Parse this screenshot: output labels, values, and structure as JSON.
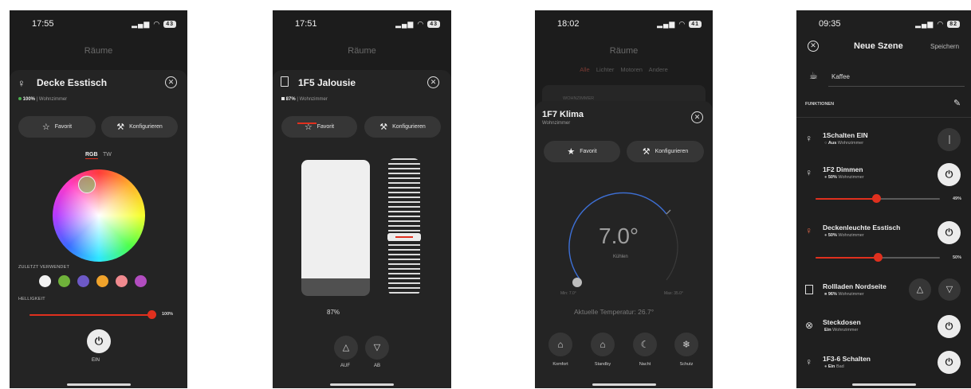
{
  "colors": {
    "accent": "#e0301e",
    "background": "#1c1c1c",
    "sheet": "#242424",
    "button": "#363636"
  },
  "screen1": {
    "time": "17:55",
    "battery": "43",
    "bg_title": "Räume",
    "title": "Decke Esstisch",
    "status_value": "100%",
    "status_room": "| Wohnzimmer",
    "favorite_label": "Favorit",
    "configure_label": "Konfigurieren",
    "mode_rgb": "RGB",
    "mode_tw": "TW",
    "recent_label": "ZULETZT VERWENDET",
    "recent_colors": [
      "#f2f2f2",
      "#6fb23a",
      "#6d59c6",
      "#f0a32b",
      "#f08a8f",
      "#b24dc0"
    ],
    "brightness_label": "HELLIGKEIT",
    "brightness_value": "100%",
    "brightness_fraction": 1.0,
    "power_state": "EIN"
  },
  "screen2": {
    "time": "17:51",
    "battery": "43",
    "bg_title": "Räume",
    "title": "1F5 Jalousie",
    "status_value": "87%",
    "status_room": "| Wohnzimmer",
    "favorite_label": "Favorit",
    "configure_label": "Konfigurieren",
    "position_value": "87%",
    "position_fraction": 0.87,
    "up_label": "AUF",
    "down_label": "AB"
  },
  "screen3": {
    "time": "18:02",
    "battery": "41",
    "bg_title": "Räume",
    "tabs": [
      "Alle",
      "Lichter",
      "Motoren",
      "Andere"
    ],
    "bg_room": "WOHNZIMMER",
    "title": "1F7 Klima",
    "subtitle": "Wohnzimmer",
    "favorite_label": "Favorit",
    "configure_label": "Konfigurieren",
    "setpoint": "7.0°",
    "mode_text": "Kühlen",
    "min_label": "Min: 7.0°",
    "max_label": "Max: 35.0°",
    "current_temp": "Aktuelle Temperatur: 26.7°",
    "modes": [
      "Komfort",
      "Standby",
      "Nacht",
      "Schutz"
    ]
  },
  "screen4": {
    "time": "09:35",
    "battery": "82",
    "title": "Neue Szene",
    "save_label": "Speichern",
    "scene_name": "Kaffee",
    "functions_label": "FUNKTIONEN",
    "rows": [
      {
        "name": "1Schalten EIN",
        "state": "Aus",
        "room": "Wohnzimmer"
      },
      {
        "name": "1F2 Dimmen",
        "state": "50%",
        "room": "Wohnzimmer",
        "slider_value": "49%",
        "slider_fraction": 0.49
      },
      {
        "name": "Deckenleuchte Esstisch",
        "state": "50%",
        "room": "Wohnzimmer",
        "slider_value": "50%",
        "slider_fraction": 0.5
      },
      {
        "name": "Rollladen Nordseite",
        "state": "96%",
        "room": "Wohnzimmer"
      },
      {
        "name": "Steckdosen",
        "state": "Ein",
        "room": "Wohnzimmer"
      },
      {
        "name": "1F3-6 Schalten",
        "state": "Ein",
        "room": "Bad"
      }
    ]
  }
}
